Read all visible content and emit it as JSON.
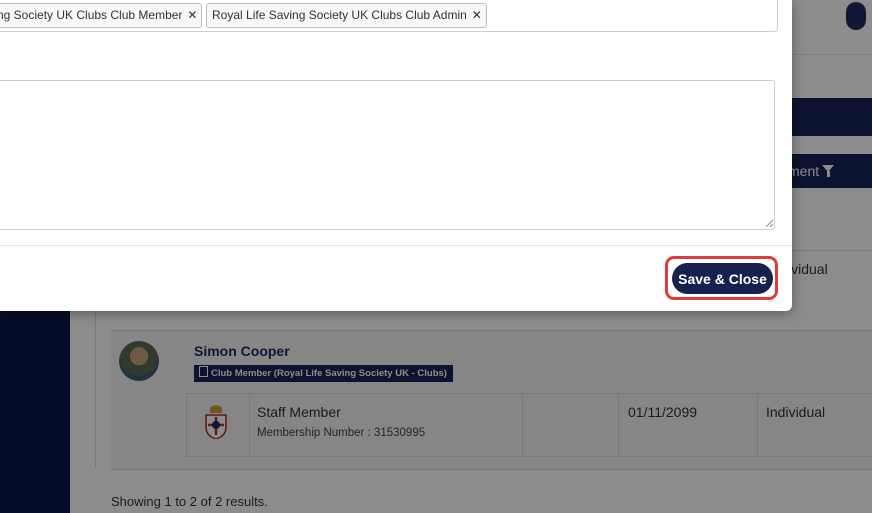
{
  "modal": {
    "tags": [
      {
        "label": "ng Society UK Clubs Club Member"
      },
      {
        "label": "Royal Life Saving Society UK Clubs Club Admin"
      }
    ],
    "tag_remove_glyph": "✕",
    "notes_value": "",
    "save_close_label": "Save & Close"
  },
  "background": {
    "column_header_label": "ment",
    "row1_type": "ividual",
    "member": {
      "name": "Simon Cooper",
      "badge": "Club Member (Royal Life Saving Society UK - Clubs)",
      "membership_title": "Staff Member",
      "membership_number": "Membership Number : 31530995",
      "date": "01/11/2099",
      "type": "Individual"
    },
    "results_text": "Showing 1 to 2 of 2 results."
  },
  "colors": {
    "navy": "#15235a",
    "button": "#16214d",
    "highlight": "#e03a3a"
  }
}
